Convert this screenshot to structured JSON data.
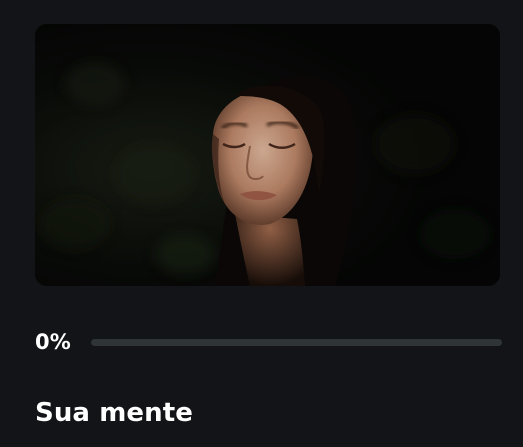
{
  "media": {
    "image_alt": "woman-face-in-sunlight-photo"
  },
  "progress": {
    "label": "0%",
    "value": 0
  },
  "content": {
    "title": "Sua mente"
  },
  "colors": {
    "background": "#131417",
    "track": "#2f3437",
    "text": "#ffffff"
  }
}
